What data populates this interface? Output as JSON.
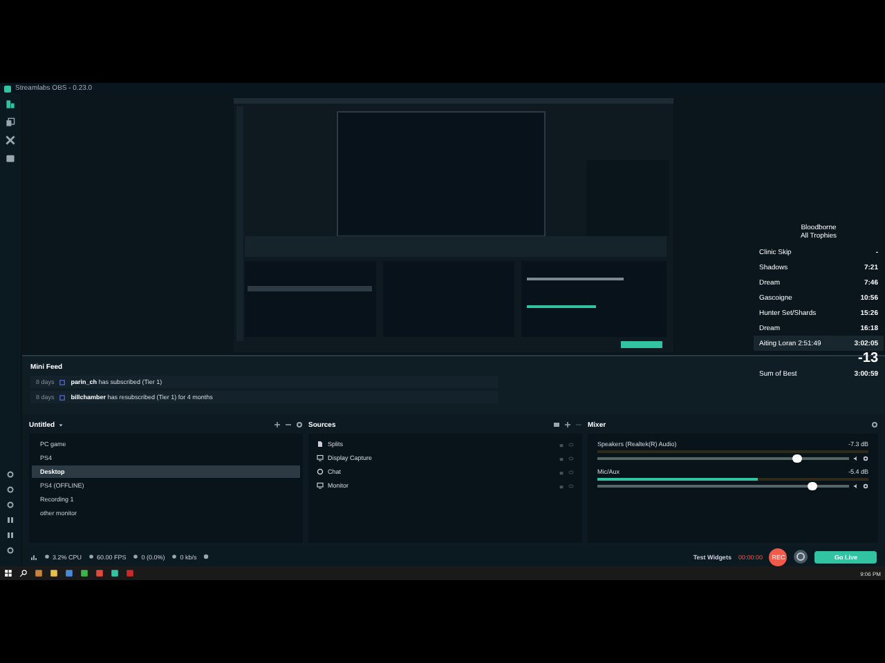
{
  "window": {
    "title": "Streamlabs OBS - 0.23.0"
  },
  "nav": [
    {
      "selected": true
    },
    {
      "selected": false
    },
    {
      "selected": false
    },
    {
      "selected": false
    }
  ],
  "splits": {
    "title": "Bloodborne",
    "subtitle": "All Trophies",
    "rows": [
      {
        "name": "Clinic Skip",
        "time": "-"
      },
      {
        "name": "Shadows",
        "time": "7:21"
      },
      {
        "name": "Dream",
        "time": "7:46"
      },
      {
        "name": "Gascoigne",
        "time": "10:56"
      },
      {
        "name": "Hunter Set/Shards",
        "time": "15:26"
      },
      {
        "name": "Dream",
        "time": "16:18"
      }
    ],
    "current": {
      "name": "Aiting Loran 2:51:49",
      "time": "3:02:05"
    },
    "delta": "-13",
    "sum": {
      "name": "Sum of Best",
      "time": "3:00:59"
    }
  },
  "mini_feed": {
    "title": "Mini Feed",
    "events": [
      {
        "age": "8 days",
        "text": "**parin_ch** has subscribed (Tier 1)"
      },
      {
        "age": "8 days",
        "text": "**billchamber** has resubscribed (Tier 1) for 4 months"
      }
    ]
  },
  "scenes": {
    "collection": "Untitled",
    "items": [
      {
        "name": "PC game",
        "selected": false
      },
      {
        "name": "PS4",
        "selected": false
      },
      {
        "name": "Desktop",
        "selected": true
      },
      {
        "name": "PS4 (OFFLINE)",
        "selected": false
      },
      {
        "name": "Recording 1",
        "selected": false
      },
      {
        "name": "other monitor",
        "selected": false
      }
    ]
  },
  "sources": {
    "title": "Sources",
    "items": [
      {
        "name": "Splits",
        "kind": "file"
      },
      {
        "name": "Display Capture",
        "kind": "monitor"
      },
      {
        "name": "Chat",
        "kind": "globe"
      },
      {
        "name": "Monitor",
        "kind": "monitor"
      }
    ]
  },
  "mixer": {
    "title": "Mixer",
    "channels": [
      {
        "name": "Speakers (Realtek(R) Audio)",
        "reading": "-7.3 dB",
        "level": 0.79
      },
      {
        "name": "Mic/Aux",
        "reading": "-5.4 dB",
        "meter": {
          "level": 0.59
        },
        "level": 0.85
      }
    ]
  },
  "status_bar": {
    "stats": [
      "3.2% CPU",
      "60.00 FPS",
      "0 (0.0%)",
      "0 kb/s"
    ],
    "test_widgets": "Test Widgets",
    "timer": "00:00:00",
    "rec": "REC",
    "go_live": "Go Live"
  },
  "taskbar": {
    "clock": "9:06 PM"
  }
}
